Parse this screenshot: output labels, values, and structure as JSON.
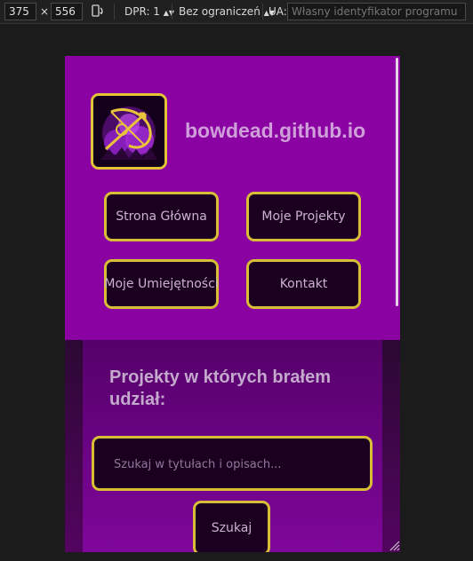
{
  "devtools": {
    "width_value": "375",
    "times": "×",
    "height_value": "556",
    "rotate_icon": "rotate-device-icon",
    "dpr_label": "DPR: 1",
    "throttle_label": "Bez ograniczeń",
    "ua_label": "UA:",
    "ua_placeholder": "Własny identyfikator programu"
  },
  "site": {
    "title": "bowdead.github.io",
    "nav": [
      "Strona Główna",
      "Moje Projekty",
      "Moje Umiejętności",
      "Kontakt"
    ],
    "section_title": "Projekty w których brałem udział:",
    "search_placeholder": "Szukaj w tytułach i opisach...",
    "search_button": "Szukaj"
  },
  "colors": {
    "header_bg": "#8b02a3",
    "accent_border": "#e2c437",
    "button_bg": "#1c0021",
    "title_text": "#cf9fd9"
  }
}
